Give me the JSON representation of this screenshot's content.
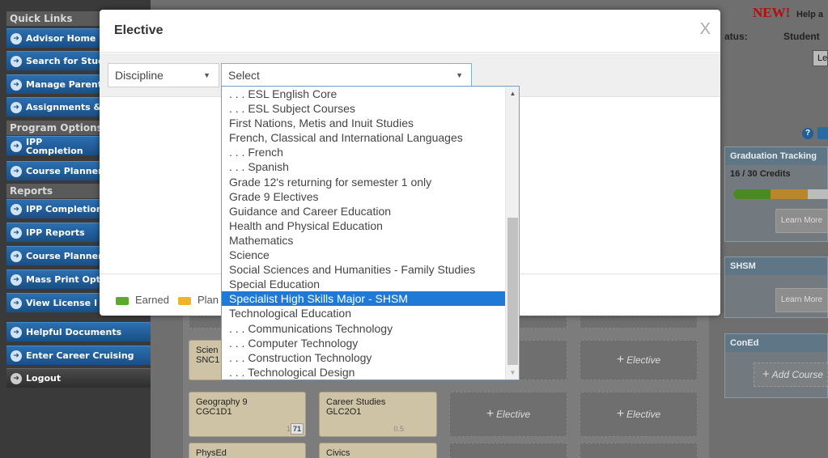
{
  "sidebar": {
    "quick_links_header": "Quick Links",
    "program_options_header": "Program Options",
    "reports_header": "Reports",
    "items": [
      {
        "label": "Advisor Home"
      },
      {
        "label": "Search for Students"
      },
      {
        "label": "Manage Parents"
      },
      {
        "label": "Assignments &"
      },
      {
        "label": "IPP Completion Standards"
      },
      {
        "label": "Course Planner"
      },
      {
        "label": "IPP Completion"
      },
      {
        "label": "IPP Reports"
      },
      {
        "label": "Course Planner"
      },
      {
        "label": "Mass Print Options"
      },
      {
        "label": "View License I"
      }
    ],
    "bottom_items": [
      {
        "label": "Helpful Documents"
      },
      {
        "label": "Enter Career Cruising"
      },
      {
        "label": "Logout"
      }
    ]
  },
  "header": {
    "new_label": "NEW!",
    "help_text": "Help a",
    "status_label": "atus:",
    "student_label": "Student",
    "btn_partial": "Le"
  },
  "right_panel": {
    "graduation_title": "Graduation Tracking",
    "credits": "16 / 30 Credits",
    "learn_more_1": "Learn More",
    "shsm_title": "SHSM",
    "learn_more_2": "Learn More",
    "coned_title": "ConEd",
    "add_course": "Add Course"
  },
  "courses": [
    {
      "name": "Scien",
      "code": "SNC1"
    },
    {
      "name": "Geography 9",
      "code": "CGC1D1",
      "num": "1",
      "grade": "71"
    },
    {
      "name": "Career Studies",
      "code": "GLC2O1",
      "num": "0.5"
    },
    {
      "name": "PhysEd",
      "code": ""
    },
    {
      "name": "Civics",
      "code": ""
    }
  ],
  "elective_label": "Elective",
  "modal": {
    "title": "Elective",
    "close": "X",
    "discipline_select": "Discipline",
    "main_select": "Select",
    "legend": [
      {
        "label": "Earned",
        "color": "#5aaa2e"
      },
      {
        "label": "Plan",
        "color": "#f0b429"
      }
    ]
  },
  "dropdown": {
    "options": [
      ". . . ESL English Core",
      ". . . ESL Subject Courses",
      "First Nations, Metis and Inuit Studies",
      "French, Classical and International Languages",
      ". . . French",
      ". . . Spanish",
      "Grade 12's returning for semester 1 only",
      "Grade 9 Electives",
      "Guidance and Career Education",
      "Health and Physical Education",
      "Mathematics",
      "Science",
      "Social Sciences and Humanities - Family Studies",
      "Special Education",
      "Specialist High Skills Major - SHSM",
      "Technological Education",
      ". . . Communications Technology",
      ". . . Computer Technology",
      ". . . Construction Technology",
      ". . . Technological Design"
    ],
    "highlighted_index": 14
  }
}
